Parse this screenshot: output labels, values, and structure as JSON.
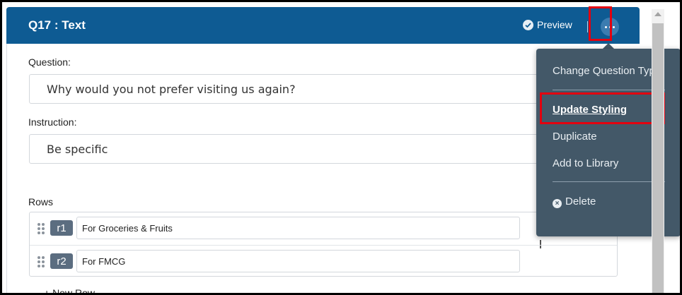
{
  "header": {
    "title": "Q17 : Text",
    "preview_label": "Preview"
  },
  "form": {
    "question_label": "Question:",
    "question_value": "Why would you not prefer visiting us again?",
    "instruction_label": "Instruction:",
    "instruction_value": "Be specific",
    "rows_label": "Rows",
    "rows": [
      {
        "code": "r1",
        "text": "For Groceries & Fruits"
      },
      {
        "code": "r2",
        "text": "For FMCG"
      }
    ],
    "new_row_label": "+ New Row"
  },
  "menu": {
    "items": [
      {
        "label": "Change Question Type"
      },
      {
        "label": "Update Styling"
      },
      {
        "label": "Duplicate"
      },
      {
        "label": "Add to Library"
      },
      {
        "label": "Delete"
      }
    ]
  },
  "colors": {
    "header_bg": "#0e5b93",
    "menu_bg": "#435868",
    "highlight": "#e3000f"
  }
}
